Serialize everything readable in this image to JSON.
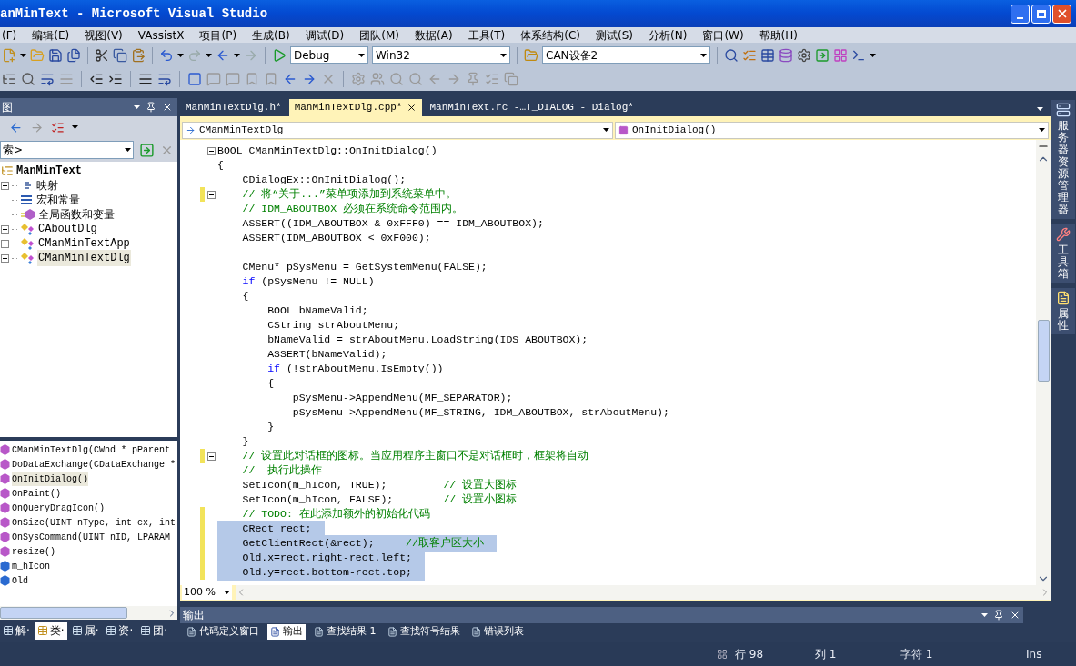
{
  "window": {
    "title": "anMinText - Microsoft Visual Studio"
  },
  "menu": [
    "(F)",
    "编辑(E)",
    "视图(V)",
    "VAssistX",
    "项目(P)",
    "生成(B)",
    "调试(D)",
    "团队(M)",
    "数据(A)",
    "工具(T)",
    "体系结构(C)",
    "测试(S)",
    "分析(N)",
    "窗口(W)",
    "帮助(H)"
  ],
  "toolbar": {
    "configuration": "Debug",
    "platform": "Win32",
    "target": "CAN设备2"
  },
  "class_view": {
    "title": "图",
    "search": {
      "value": "索>"
    },
    "tree": [
      {
        "label": "ManMinText",
        "children": [
          {
            "label": "映射",
            "kind": "group",
            "expanded": false,
            "selected": false
          },
          {
            "label": "宏和常量",
            "kind": "macros",
            "selected": false
          },
          {
            "label": "全局函数和变量",
            "kind": "globals",
            "selected": false
          },
          {
            "label": "CAboutDlg",
            "kind": "class",
            "expanded": false,
            "selected": false
          },
          {
            "label": "CManMinTextApp",
            "kind": "class",
            "expanded": false,
            "selected": false
          },
          {
            "label": "CManMinTextDlg",
            "kind": "class",
            "expanded": false,
            "selected": true
          }
        ]
      }
    ],
    "members": [
      {
        "label": "CManMinTextDlg(CWnd * pParent",
        "kind": "method",
        "selected": false
      },
      {
        "label": "DoDataExchange(CDataExchange *",
        "kind": "method",
        "selected": false
      },
      {
        "label": "OnInitDialog()",
        "kind": "method",
        "selected": true
      },
      {
        "label": "OnPaint()",
        "kind": "method",
        "selected": false
      },
      {
        "label": "OnQueryDragIcon()",
        "kind": "method",
        "selected": false
      },
      {
        "label": "OnSize(UINT nType, int cx, int",
        "kind": "method",
        "selected": false
      },
      {
        "label": "OnSysCommand(UINT nID, LPARAM",
        "kind": "method",
        "selected": false
      },
      {
        "label": "resize()",
        "kind": "method",
        "selected": false
      },
      {
        "label": "m_hIcon",
        "kind": "field",
        "selected": false
      },
      {
        "label": "Old",
        "kind": "field",
        "selected": false
      }
    ],
    "bottom_tabs": [
      {
        "label": "解·",
        "selected": false
      },
      {
        "label": "类·",
        "selected": true
      },
      {
        "label": "属·",
        "selected": false
      },
      {
        "label": "资·",
        "selected": false
      },
      {
        "label": "团·",
        "selected": false
      }
    ]
  },
  "editor": {
    "tabs": [
      {
        "label": "ManMinTextDlg.h*",
        "selected": false
      },
      {
        "label": "ManMinTextDlg.cpp*",
        "selected": true
      },
      {
        "label": "ManMinText.rc -…T_DIALOG - Dialog*",
        "selected": false
      }
    ],
    "class_combo": "CManMinTextDlg",
    "member_combo": "OnInitDialog()",
    "lines": [
      {
        "fold": true,
        "changed": false,
        "selected": false,
        "segments": [
          {
            "kind": "code",
            "text": "BOOL CManMinTextDlg::OnInitDialog()"
          }
        ]
      },
      {
        "fold": false,
        "changed": false,
        "selected": false,
        "segments": [
          {
            "kind": "code",
            "text": "{"
          }
        ]
      },
      {
        "fold": false,
        "changed": false,
        "selected": false,
        "segments": [
          {
            "kind": "code",
            "text": "    CDialogEx::OnInitDialog();"
          }
        ]
      },
      {
        "fold": true,
        "changed": true,
        "selected": false,
        "segments": [
          {
            "kind": "comment",
            "text": "    // 将“关于...”菜单项添加到系统菜单中。"
          }
        ]
      },
      {
        "fold": false,
        "changed": false,
        "selected": false,
        "segments": [
          {
            "kind": "comment",
            "text": "    // IDM_ABOUTBOX 必须在系统命令范围内。"
          }
        ]
      },
      {
        "fold": false,
        "changed": false,
        "selected": false,
        "segments": [
          {
            "kind": "code",
            "text": "    ASSERT((IDM_ABOUTBOX & 0xFFF0) == IDM_ABOUTBOX);"
          }
        ]
      },
      {
        "fold": false,
        "changed": false,
        "selected": false,
        "segments": [
          {
            "kind": "code",
            "text": "    ASSERT(IDM_ABOUTBOX < 0xF000);"
          }
        ]
      },
      {
        "fold": false,
        "changed": false,
        "selected": false
      },
      {
        "fold": false,
        "changed": false,
        "selected": false,
        "segments": [
          {
            "kind": "code",
            "text": "    CMenu* pSysMenu = GetSystemMenu(FALSE);"
          }
        ]
      },
      {
        "fold": false,
        "changed": false,
        "selected": false,
        "segments": [
          {
            "kind": "keyword",
            "text": "    if"
          },
          {
            "kind": "code",
            "text": " (pSysMenu != NULL)"
          }
        ]
      },
      {
        "fold": false,
        "changed": false,
        "selected": false,
        "segments": [
          {
            "kind": "code",
            "text": "    {"
          }
        ]
      },
      {
        "fold": false,
        "changed": false,
        "selected": false,
        "segments": [
          {
            "kind": "code",
            "text": "        BOOL bNameValid;"
          }
        ]
      },
      {
        "fold": false,
        "changed": false,
        "selected": false,
        "segments": [
          {
            "kind": "code",
            "text": "        CString strAboutMenu;"
          }
        ]
      },
      {
        "fold": false,
        "changed": false,
        "selected": false,
        "segments": [
          {
            "kind": "code",
            "text": "        bNameValid = strAboutMenu.LoadString(IDS_ABOUTBOX);"
          }
        ]
      },
      {
        "fold": false,
        "changed": false,
        "selected": false,
        "segments": [
          {
            "kind": "code",
            "text": "        ASSERT(bNameValid);"
          }
        ]
      },
      {
        "fold": false,
        "changed": false,
        "selected": false,
        "segments": [
          {
            "kind": "keyword",
            "text": "        if"
          },
          {
            "kind": "code",
            "text": " (!strAboutMenu.IsEmpty())"
          }
        ]
      },
      {
        "fold": false,
        "changed": false,
        "selected": false,
        "segments": [
          {
            "kind": "code",
            "text": "        {"
          }
        ]
      },
      {
        "fold": false,
        "changed": false,
        "selected": false,
        "segments": [
          {
            "kind": "code",
            "text": "            pSysMenu->AppendMenu(MF_SEPARATOR);"
          }
        ]
      },
      {
        "fold": false,
        "changed": false,
        "selected": false,
        "segments": [
          {
            "kind": "code",
            "text": "            pSysMenu->AppendMenu(MF_STRING, IDM_ABOUTBOX, strAboutMenu);"
          }
        ]
      },
      {
        "fold": false,
        "changed": false,
        "selected": false,
        "segments": [
          {
            "kind": "code",
            "text": "        }"
          }
        ]
      },
      {
        "fold": false,
        "changed": false,
        "selected": false,
        "segments": [
          {
            "kind": "code",
            "text": "    }"
          }
        ]
      },
      {
        "fold": true,
        "changed": true,
        "selected": false,
        "segments": [
          {
            "kind": "comment",
            "text": "    // 设置此对话框的图标。当应用程序主窗口不是对话框时，框架将自动"
          }
        ]
      },
      {
        "fold": false,
        "changed": false,
        "selected": false,
        "segments": [
          {
            "kind": "comment",
            "text": "    //  执行此操作"
          }
        ]
      },
      {
        "fold": false,
        "changed": false,
        "selected": false,
        "segments": [
          {
            "kind": "code",
            "text": "    SetIcon(m_hIcon, TRUE);         "
          },
          {
            "kind": "comment",
            "text": "// 设置大图标"
          }
        ]
      },
      {
        "fold": false,
        "changed": false,
        "selected": false,
        "segments": [
          {
            "kind": "code",
            "text": "    SetIcon(m_hIcon, FALSE);        "
          },
          {
            "kind": "comment",
            "text": "// 设置小图标"
          }
        ]
      },
      {
        "fold": false,
        "changed": true,
        "selected": false,
        "segments": [
          {
            "kind": "comment",
            "text": "    // TODO: 在此添加额外的初始化代码"
          }
        ]
      },
      {
        "fold": false,
        "changed": true,
        "selected": true,
        "segments": [
          {
            "kind": "code",
            "text": "    CRect rect;"
          }
        ]
      },
      {
        "fold": false,
        "changed": true,
        "selected": true,
        "segments": [
          {
            "kind": "code",
            "text": "    GetClientRect(&rect);     "
          },
          {
            "kind": "comment",
            "text": "//取客户区大小"
          }
        ]
      },
      {
        "fold": false,
        "changed": true,
        "selected": true,
        "segments": [
          {
            "kind": "code",
            "text": "    Old.x=rect.right-rect.left;"
          }
        ]
      },
      {
        "fold": false,
        "changed": true,
        "selected": true,
        "segments": [
          {
            "kind": "code",
            "text": "    Old.y=rect.bottom-rect.top;"
          }
        ]
      }
    ],
    "zoom": "100 %"
  },
  "output": {
    "title": "输出",
    "tabs": [
      {
        "label": "代码定义窗口",
        "selected": false
      },
      {
        "label": "输出",
        "selected": true
      },
      {
        "label": "查找结果 1",
        "selected": false
      },
      {
        "label": "查找符号结果",
        "selected": false
      },
      {
        "label": "错误列表",
        "selected": false
      }
    ]
  },
  "status_bar": {
    "line": "行 98",
    "column": "列 1",
    "char": "字符 1",
    "mode": "Ins"
  },
  "right_dock": [
    {
      "label": "服务器资源管理器",
      "kind": "server"
    },
    {
      "label": "工具箱",
      "kind": "tools"
    },
    {
      "label": "属性",
      "kind": "properties"
    }
  ]
}
